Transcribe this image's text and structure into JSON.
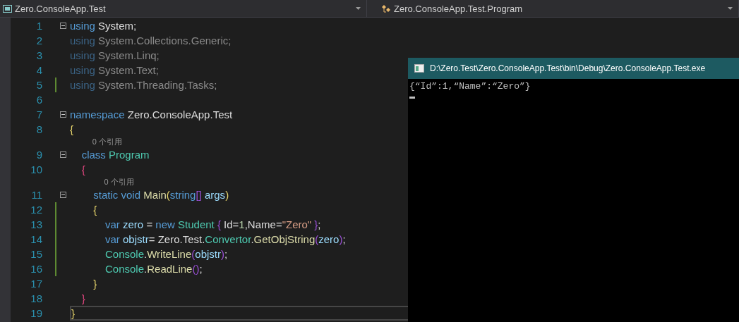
{
  "navigation_bar": {
    "project": "Zero.ConsoleApp.Test",
    "type": "Zero.ConsoleApp.Test.Program"
  },
  "editor": {
    "lines": [
      {
        "kind": "code",
        "number": "1",
        "fold": true,
        "changed": false,
        "current": false,
        "tokens": [
          {
            "text": "using",
            "kind": "kw"
          },
          {
            "text": " System;",
            "kind": "plain"
          }
        ]
      },
      {
        "kind": "code",
        "number": "2",
        "fold": false,
        "changed": false,
        "current": false,
        "tokens": [
          {
            "text": "using",
            "kind": "dimkw"
          },
          {
            "text": " System.Collections.Generic;",
            "kind": "dim"
          }
        ]
      },
      {
        "kind": "code",
        "number": "3",
        "fold": false,
        "changed": false,
        "current": false,
        "tokens": [
          {
            "text": "using",
            "kind": "dimkw"
          },
          {
            "text": " System.Linq;",
            "kind": "dim"
          }
        ]
      },
      {
        "kind": "code",
        "number": "4",
        "fold": false,
        "changed": false,
        "current": false,
        "tokens": [
          {
            "text": "using",
            "kind": "dimkw"
          },
          {
            "text": " System.Text;",
            "kind": "dim"
          }
        ]
      },
      {
        "kind": "code",
        "number": "5",
        "fold": false,
        "changed": true,
        "current": false,
        "tokens": [
          {
            "text": "using",
            "kind": "dimkw"
          },
          {
            "text": " System.Threading.Tasks;",
            "kind": "dim"
          }
        ]
      },
      {
        "kind": "code",
        "number": "6",
        "fold": false,
        "changed": false,
        "current": false
      },
      {
        "kind": "code",
        "number": "7",
        "fold": true,
        "changed": false,
        "current": false,
        "tokens": [
          {
            "text": "namespace",
            "kind": "kw"
          },
          {
            "text": " Zero.ConsoleApp.Test",
            "kind": "plain"
          }
        ]
      },
      {
        "kind": "code",
        "number": "8",
        "fold": false,
        "changed": false,
        "current": false,
        "tokens": [
          {
            "text": "{",
            "kind": "b1"
          }
        ]
      },
      {
        "kind": "lens",
        "text": "0 个引用"
      },
      {
        "kind": "code",
        "number": "9",
        "fold": true,
        "changed": false,
        "current": false,
        "tokens": [
          {
            "text": "    class",
            "kind": "kw"
          },
          {
            "text": " Program",
            "kind": "type"
          }
        ]
      },
      {
        "kind": "code",
        "number": "10",
        "fold": false,
        "changed": false,
        "current": false,
        "tokens": [
          {
            "text": "    {",
            "kind": "b2"
          }
        ]
      },
      {
        "kind": "lens",
        "text": "0 个引用"
      },
      {
        "kind": "code",
        "number": "11",
        "fold": true,
        "changed": false,
        "current": false,
        "tokens": [
          {
            "text": "        static void",
            "kind": "kw"
          },
          {
            "text": " Main",
            "kind": "method"
          },
          {
            "text": "(",
            "kind": "b1"
          },
          {
            "text": "string",
            "kind": "kw"
          },
          {
            "text": "[]",
            "kind": "b3"
          },
          {
            "text": " args",
            "kind": "param"
          },
          {
            "text": ")",
            "kind": "b1"
          }
        ]
      },
      {
        "kind": "code",
        "number": "12",
        "fold": false,
        "changed": true,
        "current": false,
        "tokens": [
          {
            "text": "        {",
            "kind": "b1"
          }
        ]
      },
      {
        "kind": "code",
        "number": "13",
        "fold": false,
        "changed": true,
        "current": false,
        "tokens": [
          {
            "text": "            var",
            "kind": "kw"
          },
          {
            "text": " zero",
            "kind": "var"
          },
          {
            "text": " = ",
            "kind": "plain"
          },
          {
            "text": "new",
            "kind": "kw"
          },
          {
            "text": " Student ",
            "kind": "type"
          },
          {
            "text": "{",
            "kind": "b3"
          },
          {
            "text": " Id=",
            "kind": "plain"
          },
          {
            "text": "1",
            "kind": "num"
          },
          {
            "text": ",Name=",
            "kind": "plain"
          },
          {
            "text": "\"Zero\"",
            "kind": "str"
          },
          {
            "text": " }",
            "kind": "b3"
          },
          {
            "text": ";",
            "kind": "plain"
          }
        ]
      },
      {
        "kind": "code",
        "number": "14",
        "fold": false,
        "changed": true,
        "current": false,
        "tokens": [
          {
            "text": "            var",
            "kind": "kw"
          },
          {
            "text": " objstr",
            "kind": "var"
          },
          {
            "text": "= Zero.Test.",
            "kind": "plain"
          },
          {
            "text": "Convertor",
            "kind": "type"
          },
          {
            "text": ".",
            "kind": "plain"
          },
          {
            "text": "GetObjString",
            "kind": "method"
          },
          {
            "text": "(",
            "kind": "b3"
          },
          {
            "text": "zero",
            "kind": "var"
          },
          {
            "text": ")",
            "kind": "b3"
          },
          {
            "text": ";",
            "kind": "plain"
          }
        ]
      },
      {
        "kind": "code",
        "number": "15",
        "fold": false,
        "changed": true,
        "current": false,
        "tokens": [
          {
            "text": "            Console",
            "kind": "type"
          },
          {
            "text": ".",
            "kind": "plain"
          },
          {
            "text": "WriteLine",
            "kind": "method"
          },
          {
            "text": "(",
            "kind": "b3"
          },
          {
            "text": "objstr",
            "kind": "var"
          },
          {
            "text": ")",
            "kind": "b3"
          },
          {
            "text": ";",
            "kind": "plain"
          }
        ]
      },
      {
        "kind": "code",
        "number": "16",
        "fold": false,
        "changed": true,
        "current": false,
        "tokens": [
          {
            "text": "            Console",
            "kind": "type"
          },
          {
            "text": ".",
            "kind": "plain"
          },
          {
            "text": "ReadLine",
            "kind": "method"
          },
          {
            "text": "()",
            "kind": "b3"
          },
          {
            "text": ";",
            "kind": "plain"
          }
        ]
      },
      {
        "kind": "code",
        "number": "17",
        "fold": false,
        "changed": false,
        "current": false,
        "tokens": [
          {
            "text": "        }",
            "kind": "b1"
          }
        ]
      },
      {
        "kind": "code",
        "number": "18",
        "fold": false,
        "changed": false,
        "current": false,
        "tokens": [
          {
            "text": "    }",
            "kind": "b2"
          }
        ]
      },
      {
        "kind": "code",
        "number": "19",
        "fold": false,
        "changed": false,
        "current": true,
        "tokens": [
          {
            "text": "}",
            "kind": "b1"
          }
        ]
      }
    ]
  },
  "console_window": {
    "title": "D:\\Zero.Test\\Zero.ConsoleApp.Test\\bin\\Debug\\Zero.ConsoleApp.Test.exe",
    "output": "{“Id”:1,“Name”:“Zero”}"
  }
}
